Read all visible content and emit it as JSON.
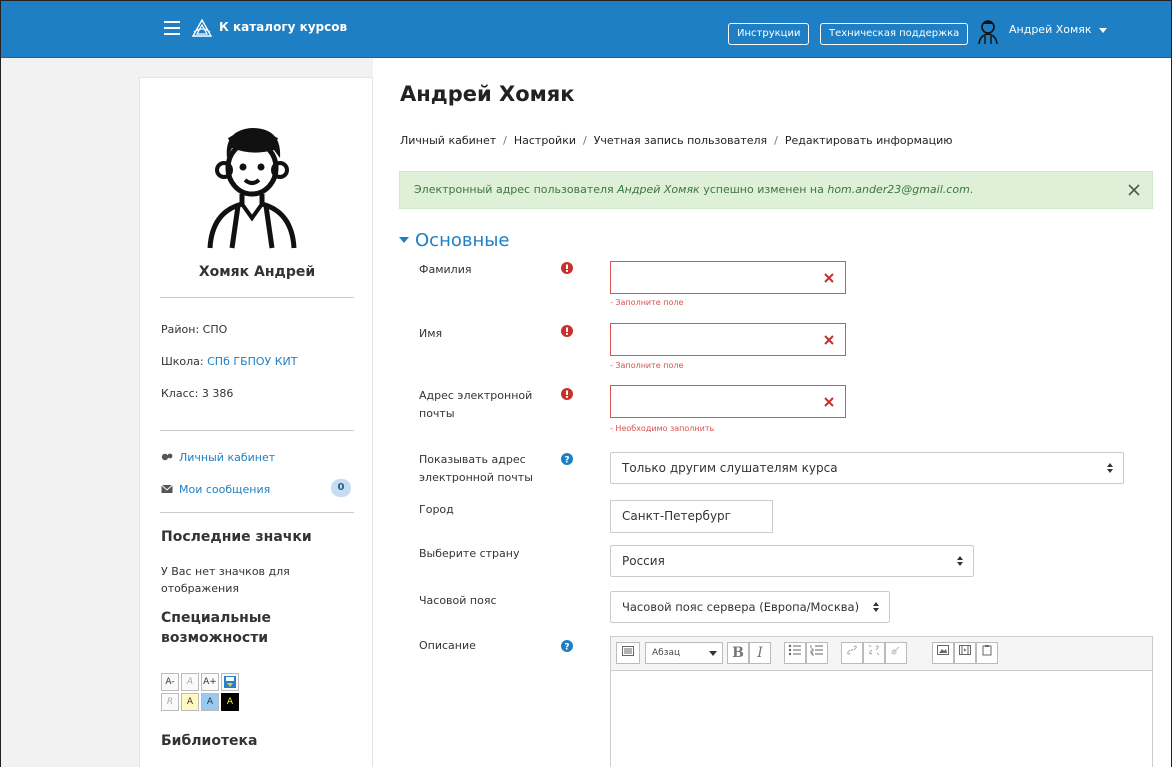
{
  "navbar": {
    "catalog_label": "К каталогу курсов",
    "instructions_label": "Инструкции",
    "support_label": "Техническая поддержка",
    "user_name": "Андрей Хомяк",
    "accent": "#1e7fc4"
  },
  "sidebar": {
    "name": "Хомяк Андрей",
    "district": "Район: СПО",
    "school_prefix": "Школа: ",
    "school_link": "СПб ГБПОУ КИТ",
    "class": "Класс: 3 386",
    "cabinet_link": "Личный кабинет",
    "messages_link": "Мои сообщения",
    "messages_count": "0",
    "badges_heading": "Последние значки",
    "badges_text": "У Вас нет значков для отображения",
    "accessibility_heading": "Специальные возможности",
    "accessibility_buttons": [
      "A-",
      "A",
      "A+",
      "R",
      "A",
      "A",
      "A"
    ],
    "library_heading": "Библиотека"
  },
  "main": {
    "title": "Андрей Хомяк",
    "breadcrumb": [
      "Личный кабинет",
      "Настройки",
      "Учетная запись пользователя",
      "Редактировать информацию"
    ],
    "alert": {
      "prefix": "Электронный адрес пользователя ",
      "user": "Андрей Хомяк",
      "middle": " успешно изменен на ",
      "email": "hom.ander23@gmail.com",
      "suffix": "."
    },
    "section_title": "Основные",
    "fields": {
      "lastname_label": "Фамилия",
      "lastname_error": "- Заполните поле",
      "firstname_label": "Имя",
      "firstname_error": "- Заполните поле",
      "email_label": "Адрес электронной почты",
      "email_error": "- Необходимо заполнить",
      "show_email_label": "Показывать адрес электронной почты",
      "show_email_value": "Только другим слушателям курса",
      "city_label": "Город",
      "city_value": "Санкт-Петербург",
      "country_label": "Выберите страну",
      "country_value": "Россия",
      "timezone_label": "Часовой пояс",
      "timezone_value": "Часовой пояс сервера (Европа/Москва)",
      "description_label": "Описание",
      "editor_format": "Абзац"
    }
  }
}
